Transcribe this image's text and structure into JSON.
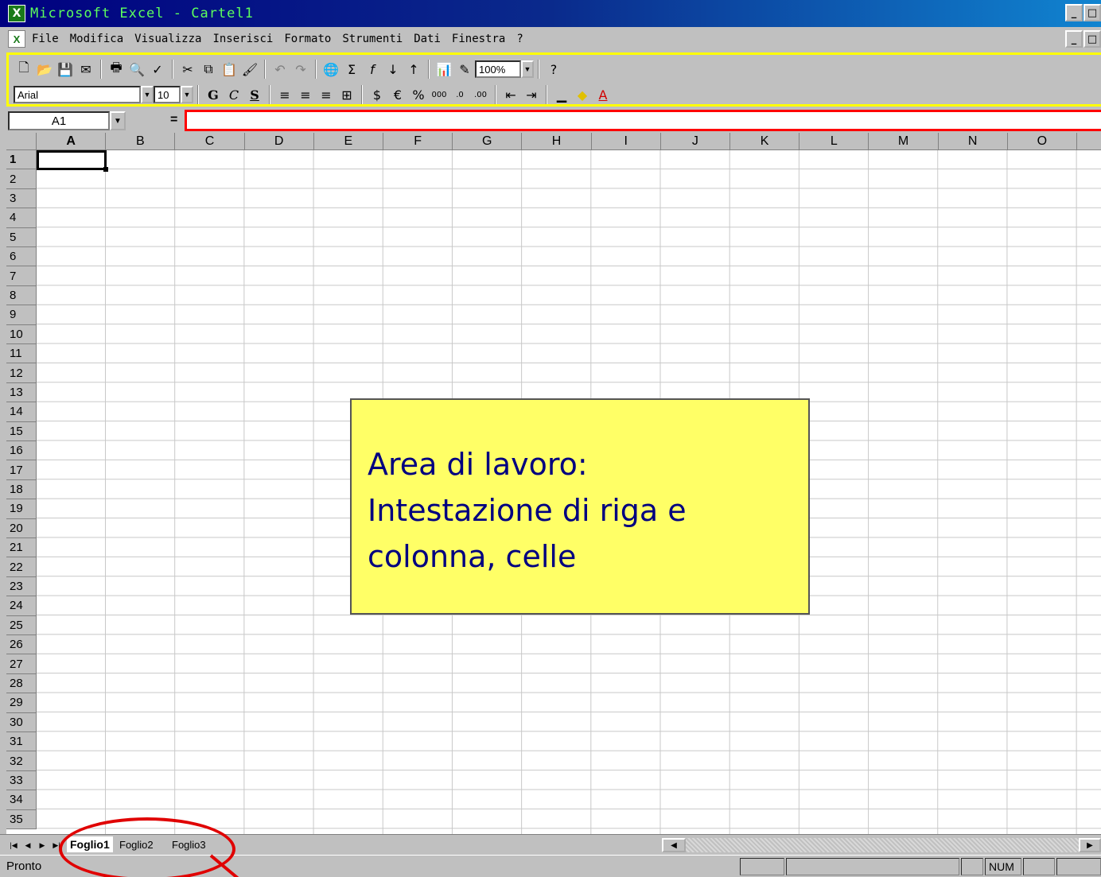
{
  "window": {
    "title": "Microsoft Excel - Cartel1",
    "app_icon": "excel-icon",
    "buttons": [
      "_",
      "□",
      "×"
    ]
  },
  "menu": {
    "items": [
      "File",
      "Modifica",
      "Visualizza",
      "Inserisci",
      "Formato",
      "Strumenti",
      "Dati",
      "Finestra",
      "?"
    ]
  },
  "toolbar": {
    "zoom": "100%",
    "font_name": "Arial",
    "font_size": "10",
    "bold_label": "G",
    "italic_label": "C",
    "underline_label": "S"
  },
  "formula_bar": {
    "name_box": "A1",
    "equals": "=",
    "content": ""
  },
  "sheet": {
    "columns": [
      "A",
      "B",
      "C",
      "D",
      "E",
      "F",
      "G",
      "H",
      "I",
      "J",
      "K",
      "L",
      "M",
      "N",
      "O"
    ],
    "rows": [
      "1",
      "2",
      "3",
      "4",
      "5",
      "6",
      "7",
      "8",
      "9",
      "10",
      "11",
      "12",
      "13",
      "14",
      "15",
      "16",
      "17",
      "18",
      "19",
      "20",
      "21",
      "22",
      "23",
      "24",
      "25",
      "26",
      "27",
      "28",
      "29",
      "30",
      "31",
      "32",
      "33",
      "34",
      "35"
    ],
    "active_cell": "A1"
  },
  "callout": {
    "line1": "Area di lavoro:",
    "line2": "Intestazione di riga e",
    "line3": "colonna, celle"
  },
  "tabs": {
    "sheets": [
      "Foglio1",
      "Foglio2",
      "Foglio3"
    ],
    "active": "Foglio1"
  },
  "status": {
    "text": "Pronto",
    "num": "NUM"
  },
  "colors": {
    "toolbar_highlight": "#ffff00",
    "formula_highlight": "#ff0000",
    "callout_bg": "#ffff66",
    "callout_text": "#000080",
    "ellipse": "#e00000"
  }
}
